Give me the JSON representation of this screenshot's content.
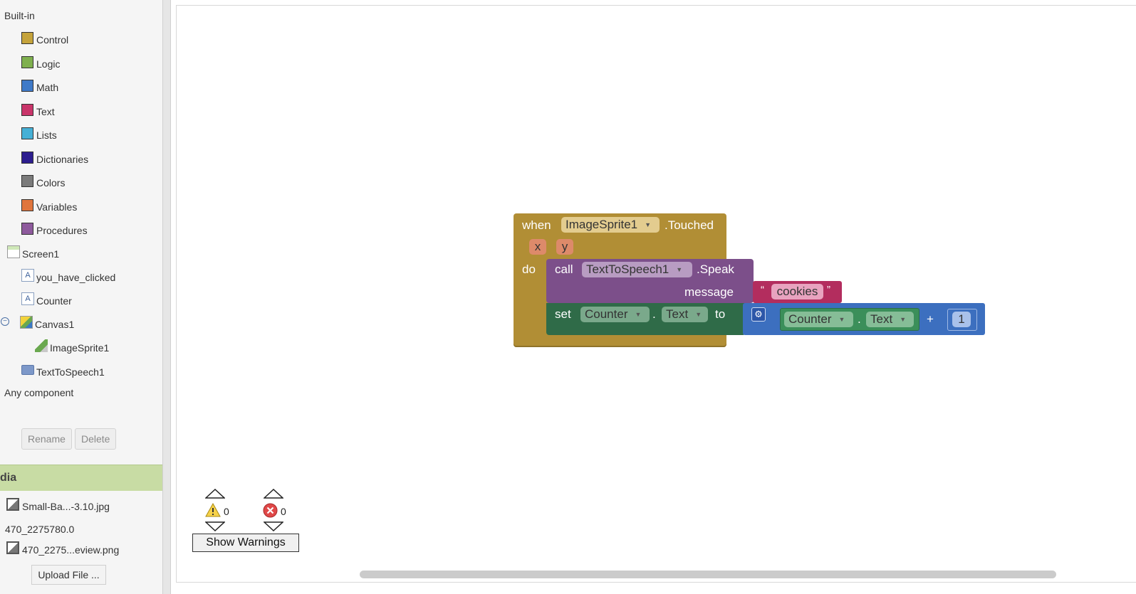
{
  "tree": {
    "builtin_label": "Built-in",
    "builtin_items": [
      {
        "label": "Control",
        "color": "#c5a33b"
      },
      {
        "label": "Logic",
        "color": "#7fb04e"
      },
      {
        "label": "Math",
        "color": "#3f7ac8"
      },
      {
        "label": "Text",
        "color": "#c9356a"
      },
      {
        "label": "Lists",
        "color": "#46b0d6"
      },
      {
        "label": "Dictionaries",
        "color": "#2d1e8f"
      },
      {
        "label": "Colors",
        "color": "#7b7b7b"
      },
      {
        "label": "Variables",
        "color": "#e0753d"
      },
      {
        "label": "Procedures",
        "color": "#8e5a9d"
      }
    ],
    "components": {
      "screen": "Screen1",
      "label1": "you_have_clicked",
      "label2": "Counter",
      "canvas": "Canvas1",
      "sprite": "ImageSprite1",
      "tts": "TextToSpeech1"
    },
    "any_component_label": "Any component",
    "rename_label": "Rename",
    "delete_label": "Delete"
  },
  "media": {
    "header": "dia",
    "files": [
      "Small-Ba...-3.10.jpg",
      "470_2275780.0",
      "470_2275...eview.png"
    ],
    "upload_label": "Upload File ..."
  },
  "blocks": {
    "event": {
      "when": "when",
      "component": "ImageSprite1",
      "event_name": ".Touched",
      "params": [
        "x",
        "y"
      ],
      "do": "do",
      "color": "#b18e35"
    },
    "call": {
      "call": "call",
      "component": "TextToSpeech1",
      "method": ".Speak",
      "arg_label": "message",
      "color": "#7c4f8a"
    },
    "text_literal": {
      "open_quote": "“",
      "value": "cookies",
      "close_quote": "”",
      "color": "#b32d5e"
    },
    "setter": {
      "set": "set",
      "component": "Counter",
      "dot": ".",
      "property": "Text",
      "to": "to",
      "color": "#2f6b48"
    },
    "math_add": {
      "operator": "+",
      "number": "1",
      "color": "#3c6fbf"
    },
    "getter": {
      "component": "Counter",
      "dot": ".",
      "property": "Text",
      "color": "#3b8f5a"
    }
  },
  "warnings": {
    "warning_count": "0",
    "error_count": "0",
    "show_warnings_label": "Show Warnings"
  }
}
